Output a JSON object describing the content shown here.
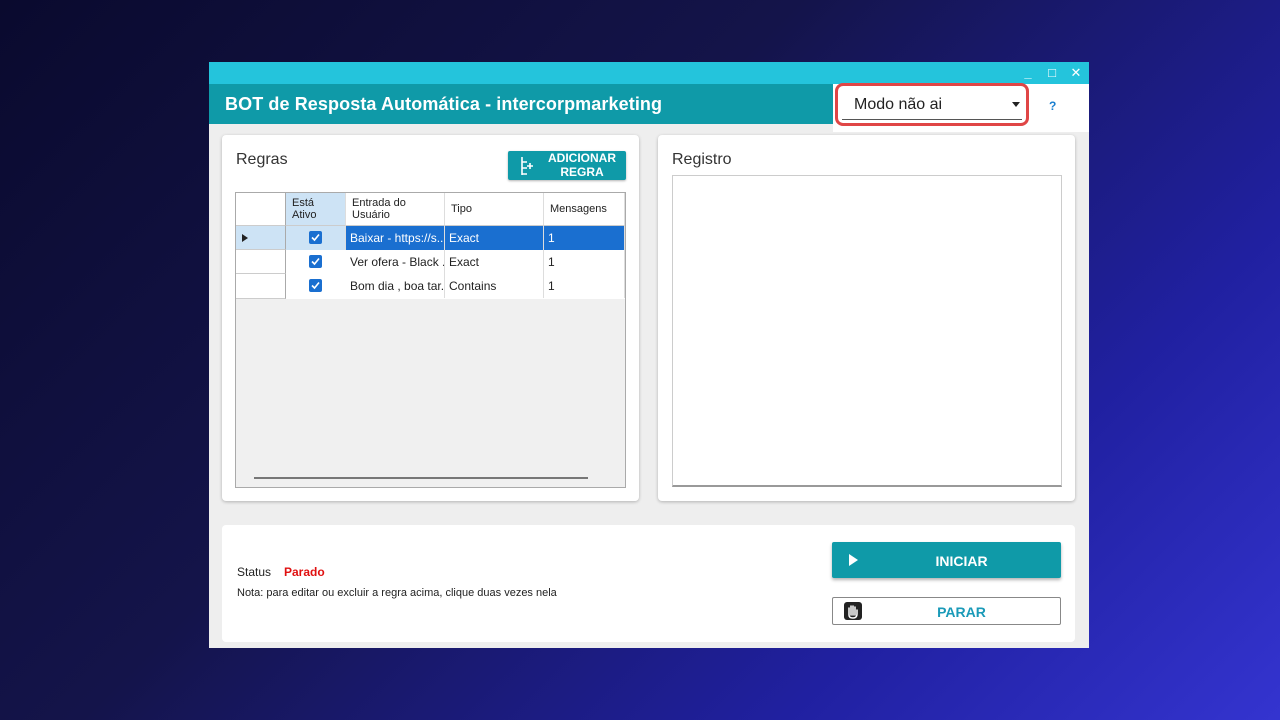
{
  "window": {
    "title": "BOT de Resposta Automática - intercorpmarketing",
    "controls": {
      "minimize": "_",
      "maximize": "□",
      "close": "✕"
    }
  },
  "mode": {
    "selected": "Modo não ai",
    "help": "?"
  },
  "rules": {
    "title": "Regras",
    "add_button_line1": "ADICIONAR",
    "add_button_line2": "REGRA",
    "columns": {
      "active_line1": "Está",
      "active_line2": "Ativo",
      "input_line1": "Entrada do",
      "input_line2": "Usuário",
      "type": "Tipo",
      "messages": "Mensagens"
    },
    "rows": [
      {
        "active": true,
        "input": "Baixar - https://s...",
        "type": "Exact",
        "messages": "1",
        "selected": true
      },
      {
        "active": true,
        "input": "Ver ofera - Black ...",
        "type": "Exact",
        "messages": "1",
        "selected": false
      },
      {
        "active": true,
        "input": "Bom dia , boa tar...",
        "type": "Contains",
        "messages": "1",
        "selected": false
      }
    ]
  },
  "log": {
    "title": "Registro"
  },
  "status": {
    "label": "Status",
    "value": "Parado",
    "note": "Nota: para editar ou excluir a regra acima, clique duas vezes nela"
  },
  "actions": {
    "start": "INICIAR",
    "stop": "PARAR"
  },
  "colors": {
    "accent": "#0f9aa8",
    "top_strip": "#24c4dc",
    "selection": "#1a6fd0",
    "status_stopped": "#e01010",
    "highlight": "#e04646"
  }
}
